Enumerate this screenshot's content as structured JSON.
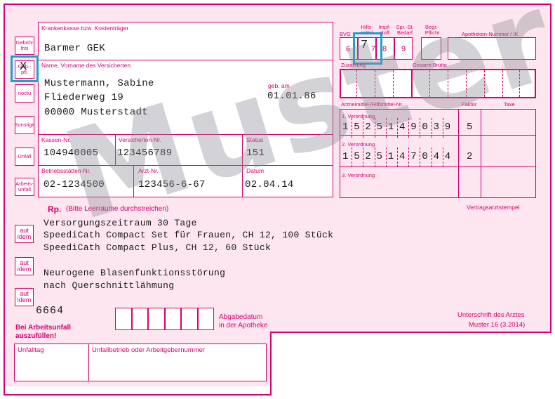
{
  "header": {
    "kasse_label": "Krankenkasse bzw. Kostenträger",
    "kasse_value": "Barmer GEK",
    "name_label": "Name, Vorname des Versicherten",
    "geb_label": "geb. am",
    "name_line1": "Mustermann, Sabine",
    "name_line2": "Fliederweg 19",
    "name_line3": "00000 Musterstadt",
    "geb_value": "01.01.86",
    "kassennr_label": "Kassen-Nr.",
    "versnr_label": "Versicherten-Nr.",
    "status_label": "Status",
    "kassennr_value": "104940005",
    "versnr_value": "123456789",
    "status_value": "151",
    "bsnr_label": "Betriebsstätten-Nr.",
    "arztnr_label": "Arzt-Nr.",
    "datum_label": "Datum",
    "bsnr_value": "02-1234500",
    "arztnr_value": "123456-6-67",
    "datum_value": "02.04.14"
  },
  "side_buttons": [
    "Gebühr frei",
    "Geb.- pfl.",
    "noctu",
    "Sonstige",
    "Unfall",
    "Arbeits- unfall"
  ],
  "geb_pfl_mark": "X",
  "top_right": {
    "bvg_label": "BVG",
    "hilfsmittel_label": "Hilfs- mittel",
    "impfstoff_label": "Impf- stoff",
    "spr_label": "Spr.-St. Bedarf",
    "begr_label": "Begr.- Pflicht",
    "apotheken_label": "Apotheken-Nummer / IK",
    "box6": "6",
    "box7": "7",
    "box8": "8",
    "box9": "9",
    "zuzahlung_label": "Zuzahlung",
    "gesamt_label": "Gesamt-Brutto",
    "arzneimittel_label": "Arzneimittel-/Hilfsmittel-Nr.",
    "faktor_label": "Faktor",
    "taxe_label": "Taxe",
    "vo1_label": "1. Verordnung",
    "vo1_digits": [
      "1",
      "5",
      "2",
      "5",
      "1",
      "4",
      "9",
      "0",
      "3",
      "9"
    ],
    "vo1_faktor": "5",
    "vo2_label": "2. Verordnung",
    "vo2_digits": [
      "1",
      "5",
      "2",
      "5",
      "1",
      "4",
      "7",
      "0",
      "4",
      "4"
    ],
    "vo2_faktor": "2",
    "vo3_label": "3. Verordnung",
    "stempel_label": "Vertragsarztstempel"
  },
  "rx": {
    "rp_label": "Rp.",
    "rp_hint": "(Bitte Leerräume durchstreichen)",
    "aut_idem": "aut idem",
    "lines": [
      "Versorgungszeitraum 30 Tage",
      "SpeediCath Compact Set für Frauen, CH 12, 100 Stück",
      "SpeediCath Compact Plus, CH 12, 60 Stück",
      "",
      "Neurogene Blasenfunktionsstörung",
      "nach Querschnittlähmung"
    ],
    "code": "6664"
  },
  "footer": {
    "abgabe_label": "Abgabedatum in der Apotheke",
    "unterschrift_label": "Unterschrift des Arztes",
    "muster_label": "Muster 16 (3.2014)",
    "arbeitsunfall_label": "Bei Arbeitsunfall auszufüllen!",
    "unfalltag_label": "Unfalltag",
    "unfallbetrieb_label": "Unfallbetrieb oder Arbeitgebernummer"
  },
  "watermark": "Muster",
  "colors": {
    "accent": "#d6006e",
    "highlight": "#1aa3d0",
    "background": "#fde6ef"
  }
}
